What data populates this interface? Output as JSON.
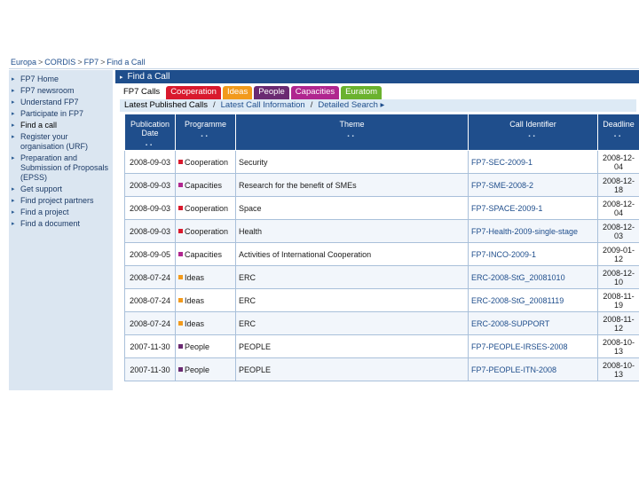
{
  "colors": {
    "header_blue": "#1f4e8c",
    "cooperation": "#d9192d",
    "ideas": "#f29a1c",
    "people": "#6a2a72",
    "capacities": "#b0268f",
    "euratom": "#6ab22e"
  },
  "breadcrumb": [
    "Europa",
    "CORDIS",
    "FP7",
    "Find a Call"
  ],
  "sidebar": {
    "items": [
      {
        "label": "FP7 Home"
      },
      {
        "label": "FP7 newsroom"
      },
      {
        "label": "Understand FP7"
      },
      {
        "label": "Participate in FP7"
      },
      {
        "label": "Find a call"
      },
      {
        "label": "Register your organisation (URF)"
      },
      {
        "label": "Preparation and Submission of Proposals (EPSS)"
      },
      {
        "label": "Get support"
      },
      {
        "label": "Find project partners"
      },
      {
        "label": "Find a project"
      },
      {
        "label": "Find a document"
      }
    ]
  },
  "findbar": {
    "title": "Find a Call"
  },
  "tabs": [
    {
      "label": "FP7 Calls",
      "bg": "#ffffff",
      "fg": "#000000"
    },
    {
      "label": "Cooperation",
      "bg": "#d9192d",
      "fg": "#ffffff"
    },
    {
      "label": "Ideas",
      "bg": "#f29a1c",
      "fg": "#ffffff"
    },
    {
      "label": "People",
      "bg": "#6a2a72",
      "fg": "#ffffff"
    },
    {
      "label": "Capacities",
      "bg": "#b0268f",
      "fg": "#ffffff"
    },
    {
      "label": "Euratom",
      "bg": "#6ab22e",
      "fg": "#ffffff"
    }
  ],
  "subnav": {
    "latest_published": "Latest Published Calls",
    "latest_info": "Latest Call Information",
    "detailed_search": "Detailed Search ▸"
  },
  "table": {
    "headers": {
      "publication_date": "Publication Date",
      "programme": "Programme",
      "theme": "Theme",
      "call_identifier": "Call Identifier",
      "deadline": "Deadline",
      "sort_glyph": "▪▪"
    },
    "rows": [
      {
        "date": "2008-09-03",
        "programme": "Cooperation",
        "color": "#d9192d",
        "theme": "Security",
        "call_id": "FP7-SEC-2009-1",
        "deadline": "2008-12-04"
      },
      {
        "date": "2008-09-03",
        "programme": "Capacities",
        "color": "#b0268f",
        "theme": "Research for the benefit of SMEs",
        "call_id": "FP7-SME-2008-2",
        "deadline": "2008-12-18"
      },
      {
        "date": "2008-09-03",
        "programme": "Cooperation",
        "color": "#d9192d",
        "theme": "Space",
        "call_id": "FP7-SPACE-2009-1",
        "deadline": "2008-12-04"
      },
      {
        "date": "2008-09-03",
        "programme": "Cooperation",
        "color": "#d9192d",
        "theme": "Health",
        "call_id": "FP7-Health-2009-single-stage",
        "deadline": "2008-12-03"
      },
      {
        "date": "2008-09-05",
        "programme": "Capacities",
        "color": "#b0268f",
        "theme": "Activities of International Cooperation",
        "call_id": "FP7-INCO-2009-1",
        "deadline": "2009-01-12"
      },
      {
        "date": "2008-07-24",
        "programme": "Ideas",
        "color": "#f29a1c",
        "theme": "ERC",
        "call_id": "ERC-2008-StG_20081010",
        "deadline": "2008-12-10"
      },
      {
        "date": "2008-07-24",
        "programme": "Ideas",
        "color": "#f29a1c",
        "theme": "ERC",
        "call_id": "ERC-2008-StG_20081119",
        "deadline": "2008-11-19"
      },
      {
        "date": "2008-07-24",
        "programme": "Ideas",
        "color": "#f29a1c",
        "theme": "ERC",
        "call_id": "ERC-2008-SUPPORT",
        "deadline": "2008-11-12"
      },
      {
        "date": "2007-11-30",
        "programme": "People",
        "color": "#6a2a72",
        "theme": "PEOPLE",
        "call_id": "FP7-PEOPLE-IRSES-2008",
        "deadline": "2008-10-13"
      },
      {
        "date": "2007-11-30",
        "programme": "People",
        "color": "#6a2a72",
        "theme": "PEOPLE",
        "call_id": "FP7-PEOPLE-ITN-2008",
        "deadline": "2008-10-13"
      }
    ]
  }
}
